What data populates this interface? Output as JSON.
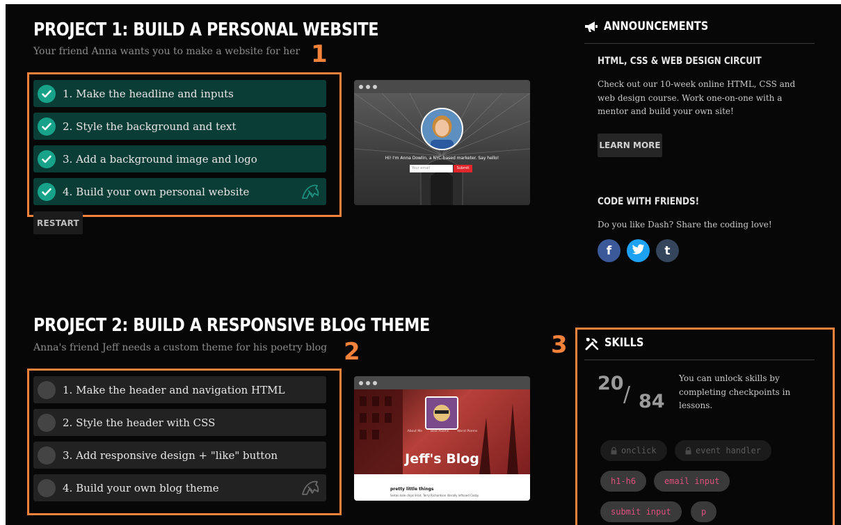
{
  "project1": {
    "title": "PROJECT 1: BUILD A PERSONAL WEBSITE",
    "subtitle": "Your friend Anna wants you to make a website for her",
    "callout": "1",
    "tasks": [
      {
        "label": "1. Make the headline and inputs",
        "done": true
      },
      {
        "label": "2. Style the background and text",
        "done": true
      },
      {
        "label": "3. Add a background image and logo",
        "done": true
      },
      {
        "label": "4. Build your own personal website",
        "done": true
      }
    ],
    "restart_label": "RESTART",
    "preview": {
      "tagline": "Hi! I'm Anna Dowlin, a NYC-based marketer. Say hello!",
      "email_placeholder": "Your email",
      "submit_label": "Submit"
    }
  },
  "project2": {
    "title": "PROJECT 2: BUILD A RESPONSIVE BLOG THEME",
    "subtitle": "Anna's friend Jeff needs a custom theme for his poetry blog",
    "callout": "2",
    "tasks": [
      {
        "label": "1. Make the header and navigation HTML",
        "done": false
      },
      {
        "label": "2. Style the header with CSS",
        "done": false
      },
      {
        "label": "3. Add responsive design + \"like\" button",
        "done": false
      },
      {
        "label": "4. Build your own blog theme",
        "done": false
      }
    ],
    "preview": {
      "blog_title": "Jeff's Blog",
      "nav": [
        "About Me",
        "Best Poems",
        "Worst Poems"
      ],
      "post_title": "pretty little things",
      "post_text": "Seitan kale chips 8-bit, Terry Richardson literally leftsoed Cosby"
    }
  },
  "announcements": {
    "heading": "ANNOUNCEMENTS",
    "circuit_title": "HTML, CSS & WEB DESIGN CIRCUIT",
    "circuit_text": "Check out our 10-week online HTML, CSS and web design course. Work one-on-one with a mentor and build your own site!",
    "learn_more_label": "LEARN MORE",
    "friends_title": "CODE WITH FRIENDS!",
    "friends_text": "Do you like Dash? Share the coding love!",
    "social": [
      {
        "name": "facebook",
        "glyph": "f",
        "color": "#3b5998"
      },
      {
        "name": "twitter",
        "glyph": "t",
        "color": "#1da1f2"
      },
      {
        "name": "tumblr",
        "glyph": "t",
        "color": "#35465c"
      }
    ]
  },
  "skills": {
    "callout": "3",
    "heading": "SKILLS",
    "unlocked": "20",
    "slash": "/",
    "total": "84",
    "description": "You can unlock skills by completing checkpoints in lessons.",
    "chips": [
      {
        "label": "onclick",
        "locked": true
      },
      {
        "label": "event handler",
        "locked": true
      },
      {
        "label": "h1-h6",
        "locked": false
      },
      {
        "label": "email input",
        "locked": false
      },
      {
        "label": "submit input",
        "locked": false
      },
      {
        "label": "p",
        "locked": false
      }
    ]
  },
  "colors": {
    "accent_orange": "#f4823a",
    "done_task_bg": "#0b3d37",
    "check_teal": "#16a389",
    "todo_task_bg": "#222222",
    "skill_pink": "#e0507a"
  }
}
